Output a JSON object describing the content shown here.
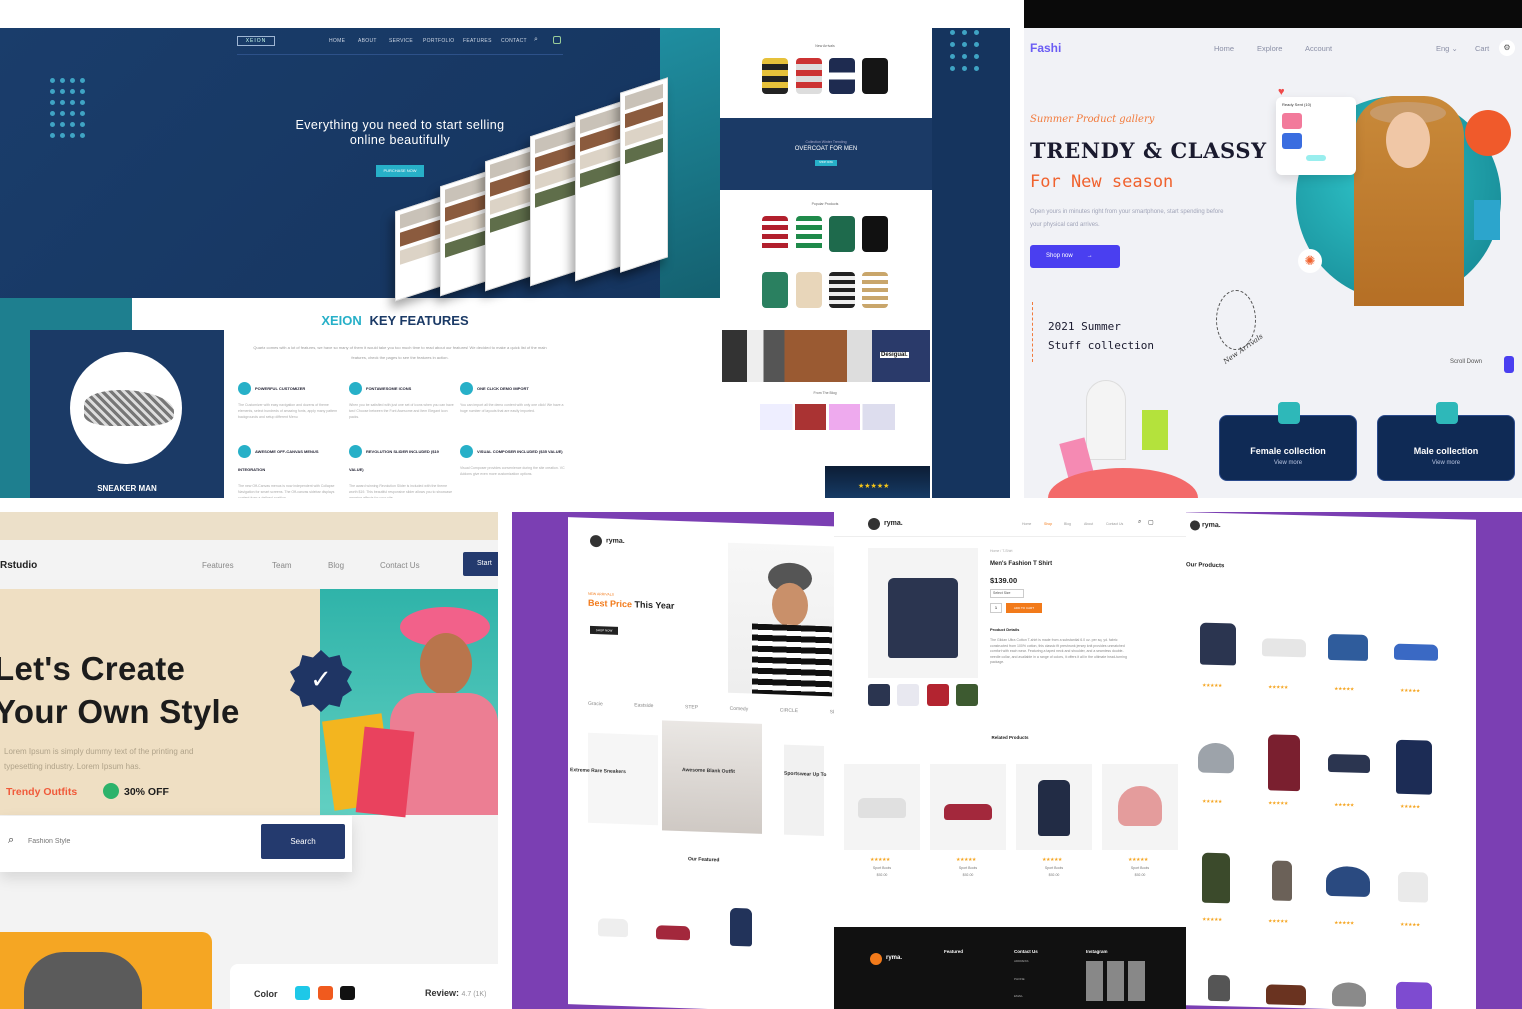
{
  "xeion": {
    "logo": "XEION",
    "nav": [
      "HOME",
      "ABOUT",
      "SERVICE",
      "PORTFOLIO",
      "FEATURES",
      "CONTACT"
    ],
    "tagline_line1": "Everything you need to start selling",
    "tagline_line2": "online beautifully",
    "cta": "PURCHASE NOW",
    "sneaker_label": "SNEAKER MAN",
    "key_features_brand": "XEION",
    "key_features_title": "KEY FEATURES",
    "intro": "Quartz comes with a lot of features, we have so many of them it would take you too much time to read about our features! We decided to make a quick list of the main features, check the pages to see the features in action.",
    "features": [
      {
        "title": "POWERFUL CUSTOMIZER",
        "text": "The Customizer with easy navigation and dozens of theme elements, select hundreds of amazing fonts, apply many pattern backgrounds and setup different Menu"
      },
      {
        "title": "FONTAWESOME ICONS",
        "text": "When you be satisfied with just one set of icons when you can have two! Choose between the Font Awesome and Item Elegant Icon packs."
      },
      {
        "title": "ONE CLICK DEMO IMPORT",
        "text": "You can import all the demo content with only one click! We have a huge number of layouts that are easily imported."
      },
      {
        "title": "AWESOME OFF-CANVAS MENUS INTEGRATION",
        "text": "The new Off-Canvas menus is now independent with Collapse Navigation for smart screens. The Off-canvas sidebar displays content from a defined position."
      },
      {
        "title": "REVOLUTION SLIDER INCLUDED ($19 VALUE)",
        "text": "The award winning Revolution Slider is included with the theme worth $19. This beautiful responsive slider allows you to showcase amazing effects for your site."
      },
      {
        "title": "VISUAL COMPOSER INCLUDED ($35 VALUE)",
        "text": "Visual Composer provides convenience during the site creation. VC Addons give even more customization options."
      }
    ],
    "strip": {
      "new_arrivals": "New Arrivals",
      "overcoat_small": "Collection Winter Trending",
      "overcoat": "OVERCOAT FOR MEN",
      "overcoat_btn": "SHOP NOW",
      "popular": "Popular Products",
      "desigual": "Desigual.",
      "from_blog": "From The Blog"
    }
  },
  "fashi": {
    "logo": "Fashi",
    "nav": [
      "Home",
      "Explore",
      "Account"
    ],
    "lang": "Eng",
    "cart": "Cart",
    "script": "Summer Product gallery",
    "title1": "TRENDY & CLASSY",
    "title2": "For New season",
    "desc": "Open yours in minutes right from your smartphone, start spending before your physical card arrives.",
    "shop_btn": "Shop now",
    "summer": [
      "2021 Summer",
      "Stuff collection"
    ],
    "new_arrivals": "New Arrivals",
    "scroll": "Scroll Down",
    "card_title": "Ready Sent (10)",
    "collections": [
      {
        "title": "Female collection",
        "link": "View more"
      },
      {
        "title": "Male collection",
        "link": "View more"
      }
    ],
    "colors": {
      "accent": "#4a3ff0",
      "orange": "#f0622e",
      "teal": "#2ec3c8",
      "navy": "#0f2a55"
    }
  },
  "rstudio": {
    "logo": "Rstudio",
    "nav": [
      "Features",
      "Team",
      "Blog",
      "Contact Us"
    ],
    "start_btn": "Start",
    "headline1": "Let's Create",
    "headline2": "Your Own Style",
    "sub": "Lorem Ipsum is simply dummy text of the printing and typesetting industry. Lorem Ipsum has.",
    "trendy": "Trendy Outfits",
    "off": "30% OFF",
    "search_placeholder": "Fashion Style",
    "search_btn": "Search",
    "color_label": "Color",
    "review_label": "Review:",
    "review_value": "4.7 (1K)",
    "swatches": [
      "#1ec8e8",
      "#f05a1e",
      "#111111"
    ]
  },
  "ryma": {
    "logo": "ryma.",
    "nav": [
      "Home",
      "Shop",
      "Blog",
      "About",
      "Contact Us"
    ],
    "new_small": "NEW ARRIVALS",
    "best_price": "Best Price",
    "this_year": "This Year",
    "shop_btn": "SHOP NOW",
    "brands": [
      "Gracie",
      "Eastside",
      "STEP",
      "Comedy",
      "CIRCLE",
      "SkillStar"
    ],
    "banners": [
      "Extreme Rare Sneakers",
      "Awesome Blank Outfit",
      "Sportswear Up To"
    ],
    "featured": "Our Featured",
    "product_name": "Men's Fashion T Shirt",
    "breadcrumb": "Home / T-Shirt",
    "price": "$139.00",
    "select_size": "Select Size",
    "qty": "1",
    "add_to_cart": "ADD TO CART",
    "product_details": "Product Details",
    "details_text": "The Gildan Ultra Cotton T-shirt is made from a substantial 6.0 oz. per sq. yd. fabric constructed from 100% cotton, this classic fit preshrunk jersey knit provides unmatched comfort with each wear. Featuring a taped neck and shoulder, and a seamless double-needle collar, and available in a range of colors, it offers it all in the ultimate head-turning package.",
    "related": "Related Products",
    "item_name": "Sport Boots",
    "item_price": "$92.00",
    "stars": "★★★★★",
    "our_products": "Our Products",
    "footer_cols": [
      "Featured",
      "Contact Us",
      "Instagram"
    ],
    "footer_contact": [
      "ADDRESS",
      "PHONE",
      "EMAIL"
    ]
  }
}
